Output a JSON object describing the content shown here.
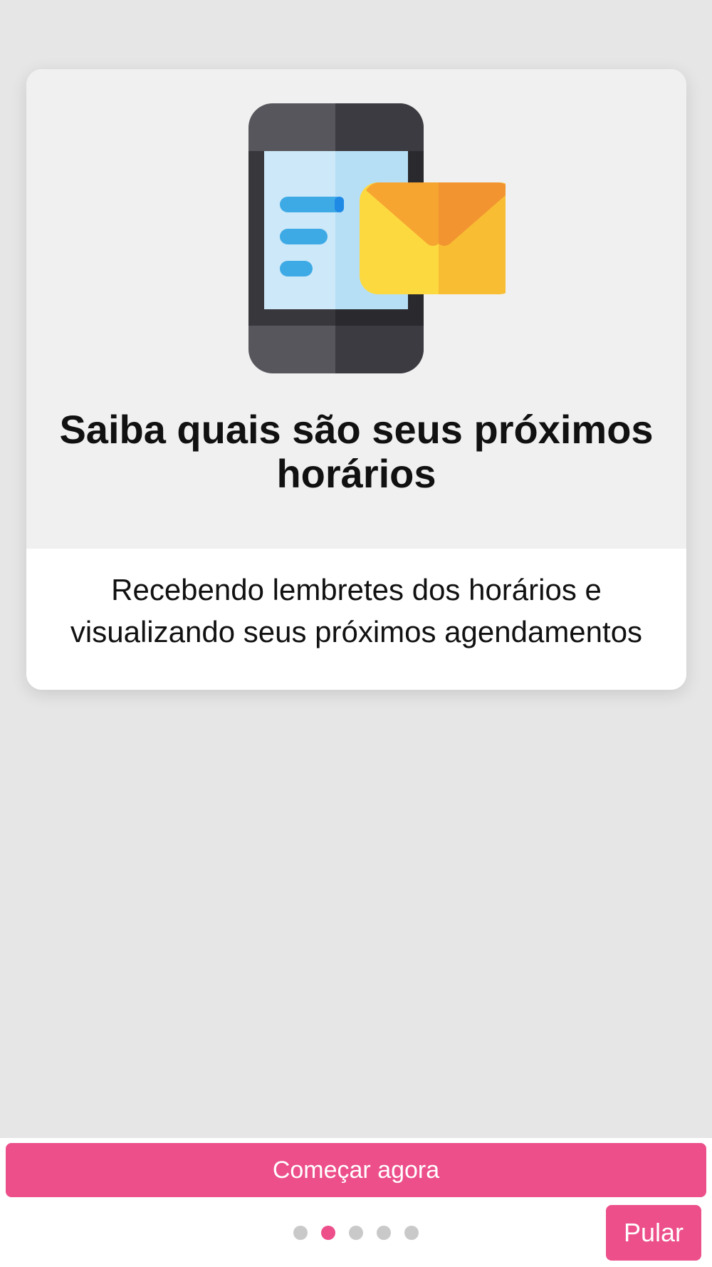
{
  "onboarding": {
    "title": "Saiba quais são seus próximos horários",
    "description": "Recebendo lembretes dos horários e visualizando seus próximos agendamentos",
    "illustration_icon": "phone-with-message-envelope-icon"
  },
  "footer": {
    "start_label": "Começar agora",
    "skip_label": "Pular",
    "pagination": {
      "total_pages": 5,
      "current_page": 2
    }
  },
  "colors": {
    "accent": "#ec4f8a",
    "background": "#e6e6e6",
    "card_top": "#f0f0f0",
    "dot_inactive": "#c9c9c9"
  }
}
